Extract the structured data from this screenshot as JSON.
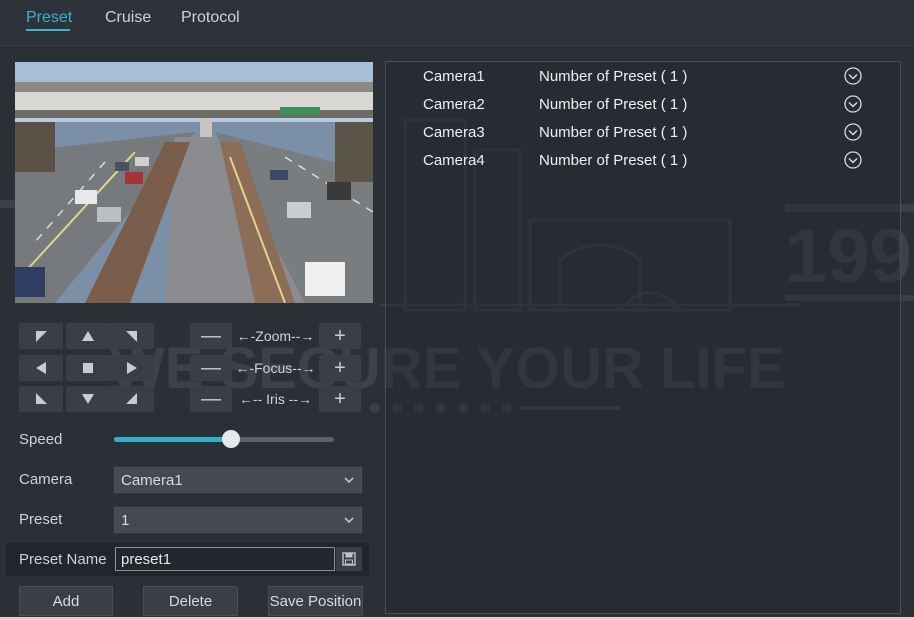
{
  "tabs": [
    {
      "label": "Preset",
      "active": true
    },
    {
      "label": "Cruise",
      "active": false
    },
    {
      "label": "Protocol",
      "active": false
    }
  ],
  "ptz": {
    "zoom_label": "←-Zoom--→",
    "focus_label": "←-Focus--→",
    "iris_label": "←-- Iris --→",
    "minus_icon": "minus-icon",
    "plus_icon": "plus-icon"
  },
  "speed": {
    "label": "Speed",
    "value_fraction": 0.53
  },
  "camera": {
    "label": "Camera",
    "value": "Camera1"
  },
  "preset": {
    "label": "Preset",
    "value": "1"
  },
  "preset_name": {
    "label": "Preset Name",
    "value": "preset1"
  },
  "actions": {
    "add": "Add",
    "delete": "Delete",
    "save_position": "Save Position"
  },
  "camera_list": [
    {
      "camera": "Camera1",
      "presets": "Number of Preset ( 1 )"
    },
    {
      "camera": "Camera2",
      "presets": "Number of Preset ( 1 )"
    },
    {
      "camera": "Camera3",
      "presets": "Number of Preset ( 1 )"
    },
    {
      "camera": "Camera4",
      "presets": "Number of Preset ( 1 )"
    }
  ],
  "watermark": {
    "text": "WE SECURE YOUR LIFE",
    "year_partial": "199"
  },
  "colors": {
    "accent": "#33b6d2",
    "background": "#2b2f36",
    "control": "#3a3f47"
  }
}
